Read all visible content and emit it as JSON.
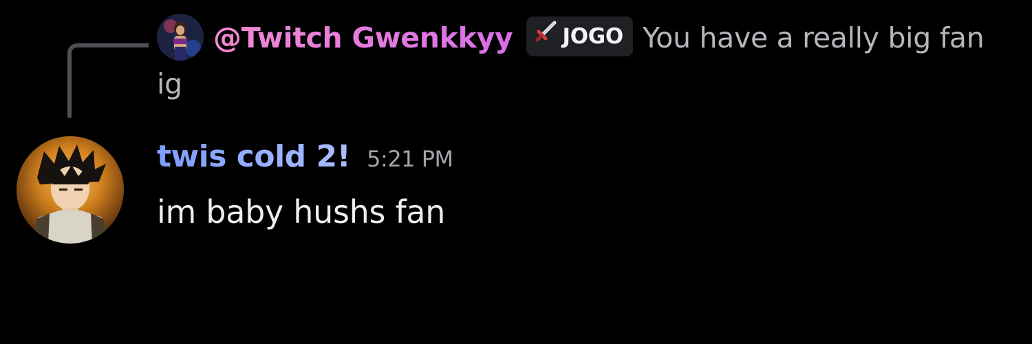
{
  "reply": {
    "author": "@Twitch Gwenkkyy",
    "guild_tag": "JOGO",
    "text": "You have a really big fan ig",
    "author_color": "#e879d8"
  },
  "message": {
    "author": "twis cold 2!",
    "timestamp": "5:21 PM",
    "content": "im baby hushs fan",
    "author_color": "#8aa8ff"
  },
  "icons": {
    "guild_tag_icon": "sword-icon"
  },
  "colors": {
    "background": "#000000",
    "reply_spine": "#4e5058",
    "guild_tag_bg": "#1f2024"
  }
}
